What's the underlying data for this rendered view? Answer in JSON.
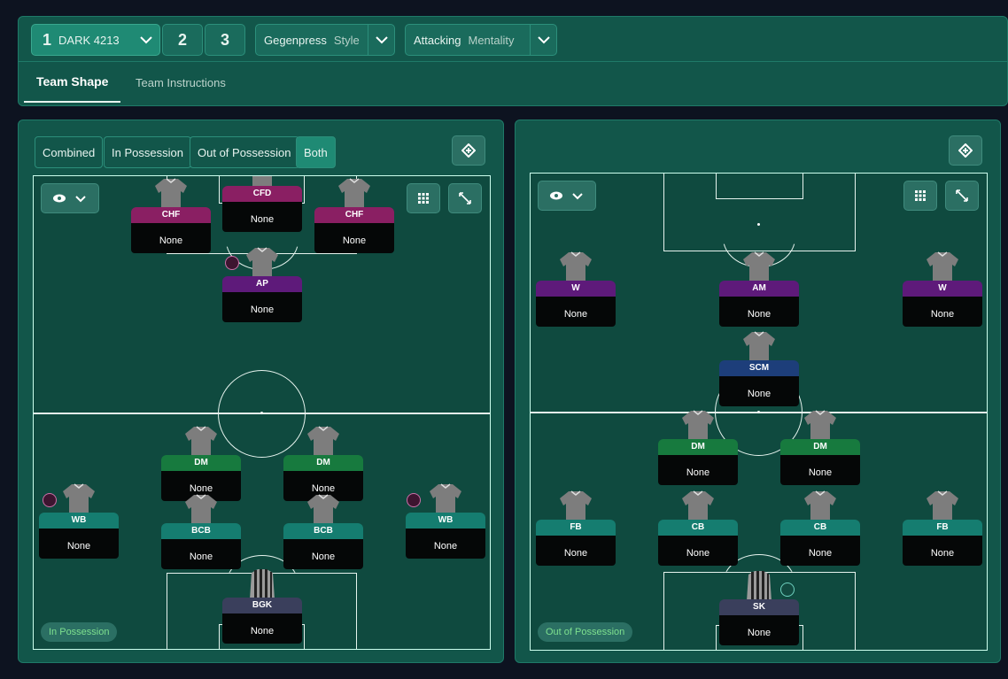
{
  "header": {
    "tactics": [
      {
        "num": "1",
        "name": "DARK 4213"
      },
      {
        "num": "2"
      },
      {
        "num": "3"
      }
    ],
    "style": {
      "value": "Gegenpress",
      "label": "Style"
    },
    "mentality": {
      "value": "Attacking",
      "label": "Mentality"
    },
    "tabs": [
      "Team Shape",
      "Team Instructions"
    ]
  },
  "left_panel": {
    "view_modes": [
      "Combined",
      "In Possession",
      "Out of Possession",
      "Both"
    ],
    "active_view_mode": "Both",
    "chip": "In Possession",
    "players": [
      {
        "role": "CHF",
        "name": "None",
        "color": "#8a1f63"
      },
      {
        "role": "CFD",
        "name": "None",
        "color": "#8a1f63"
      },
      {
        "role": "CHF",
        "name": "None",
        "color": "#8a1f63"
      },
      {
        "role": "AP",
        "name": "None",
        "color": "#5e1a7a"
      },
      {
        "role": "DM",
        "name": "None",
        "color": "#177a3e"
      },
      {
        "role": "DM",
        "name": "None",
        "color": "#177a3e"
      },
      {
        "role": "WB",
        "name": "None",
        "color": "#157d70"
      },
      {
        "role": "BCB",
        "name": "None",
        "color": "#157d70"
      },
      {
        "role": "BCB",
        "name": "None",
        "color": "#157d70"
      },
      {
        "role": "WB",
        "name": "None",
        "color": "#157d70"
      },
      {
        "role": "BGK",
        "name": "None",
        "color": "#3a3f5c"
      }
    ]
  },
  "right_panel": {
    "chip": "Out of Possession",
    "players": [
      {
        "role": "W",
        "name": "None",
        "color": "#5e1a7a"
      },
      {
        "role": "AM",
        "name": "None",
        "color": "#5e1a7a"
      },
      {
        "role": "W",
        "name": "None",
        "color": "#5e1a7a"
      },
      {
        "role": "SCM",
        "name": "None",
        "color": "#1d3e7a"
      },
      {
        "role": "DM",
        "name": "None",
        "color": "#177a3e"
      },
      {
        "role": "DM",
        "name": "None",
        "color": "#177a3e"
      },
      {
        "role": "FB",
        "name": "None",
        "color": "#157d70"
      },
      {
        "role": "CB",
        "name": "None",
        "color": "#157d70"
      },
      {
        "role": "CB",
        "name": "None",
        "color": "#157d70"
      },
      {
        "role": "FB",
        "name": "None",
        "color": "#157d70"
      },
      {
        "role": "SK",
        "name": "None",
        "color": "#3a3f5c"
      }
    ]
  }
}
